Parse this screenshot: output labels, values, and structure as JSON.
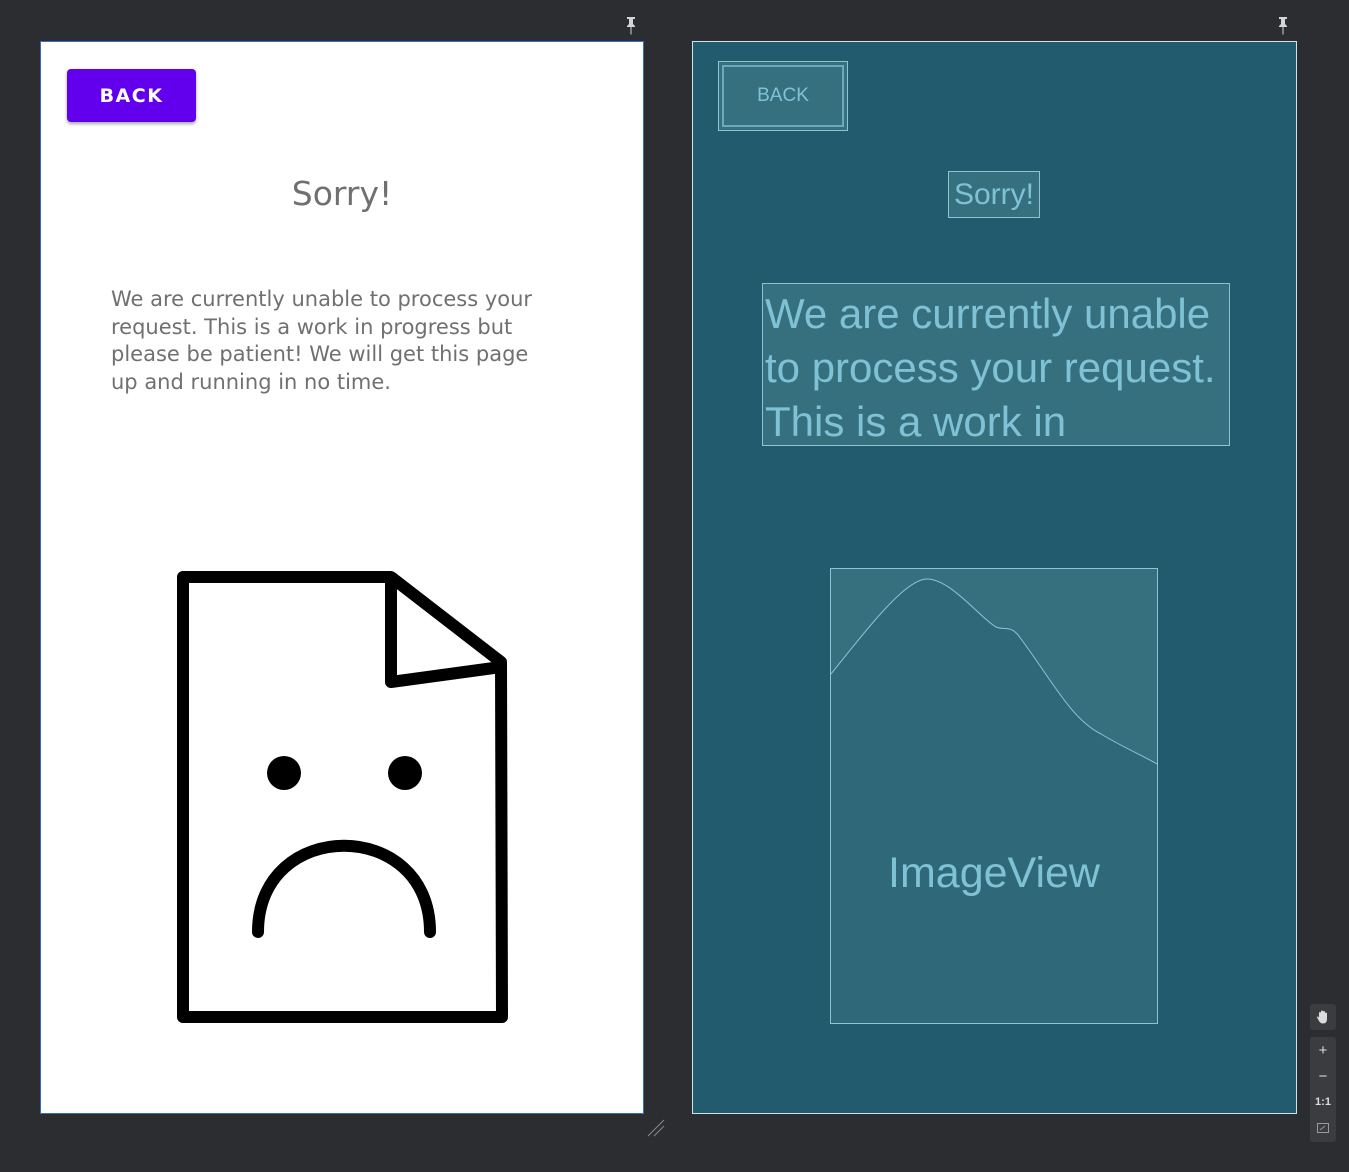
{
  "design": {
    "back_label": "BACK",
    "title": "Sorry!",
    "message": "We are currently unable to process your request. This is a work in progress but please be patient! We will get this page up and running in no time."
  },
  "blueprint": {
    "back_label": "BACK",
    "title": "Sorry!",
    "message": "We are currently unable to process your request. This is a work in",
    "image_label": "ImageView"
  },
  "zoom_toolbar": {
    "pan_icon": "hand-icon",
    "zoom_in": "+",
    "zoom_out": "−",
    "actual_size": "1:1",
    "fit_icon": "fit-screen-icon"
  },
  "colors": {
    "accent": "#6200ee",
    "blueprint_bg": "#235b6e",
    "canvas_bg": "#2b2d30"
  }
}
